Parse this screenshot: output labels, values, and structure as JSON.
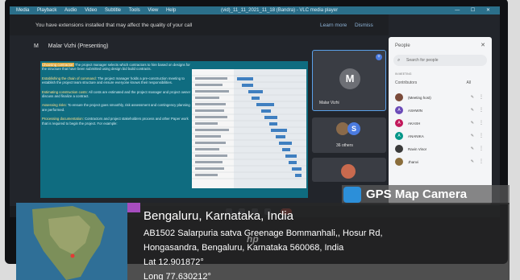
{
  "vlc": {
    "menus": [
      "Media",
      "Playback",
      "Audio",
      "Video",
      "Subtitle",
      "Tools",
      "View",
      "Help"
    ],
    "title": "(vid)_11_11_2021_11_18 (Bandra) - VLC media player",
    "window_controls": "— ☐ ✕"
  },
  "meet": {
    "notice": "You have extensions installed that may affect the quality of your call",
    "learn_more": "Learn more",
    "dismiss": "Dismiss",
    "presenter_initial": "M",
    "presenter_label": "Malar Vizhi (Presenting)",
    "slide": {
      "items": [
        {
          "head": "Choosing contractor:",
          "body": "The project manager selects which contractors to hire based on designs for the structure that have been submitted using design bid build contracts."
        },
        {
          "head": "Establishing the chain of command:",
          "body": "The project manager holds a pre-construction meeting to establish the project team structure and ensure everyone knows their responsibilities."
        },
        {
          "head": "Estimating construction costs:",
          "body": "All costs are estimated and the project manager and project owner discuss and finalize a contract."
        },
        {
          "head": "Assessing risks:",
          "body": "To ensure the project goes smoothly, risk assessment and contingency planning are performed."
        },
        {
          "head": "Processing documentation:",
          "body": "Contractors and project stakeholders process and other Paper work that is required to begin the project. For example:"
        }
      ]
    },
    "tiles": {
      "main_initial": "M",
      "main_name": "Malar Vizhi",
      "others_initial": "S",
      "others_label": "36 others"
    },
    "people": {
      "title": "People",
      "search_placeholder": "Search for people",
      "in_meeting": "IN MEETING",
      "contributors": "Contributors",
      "all": "All",
      "rows": [
        {
          "initial": "",
          "name": "(Meeting host)",
          "color": "#7a4a3a"
        },
        {
          "initial": "A",
          "name": "ASHWIN",
          "color": "#6b4bb8"
        },
        {
          "initial": "A",
          "name": "AKASH",
          "color": "#c2185b"
        },
        {
          "initial": "A",
          "name": "ANANIKA",
          "color": "#009688"
        },
        {
          "initial": "",
          "name": "Ravin Vinor",
          "color": "#3a3a3a"
        },
        {
          "initial": "",
          "name": "Jhanvi",
          "color": "#8a6d3b"
        }
      ]
    }
  },
  "gps": {
    "brand": "GPS Map Camera",
    "city": "Bengaluru, Karnataka, India",
    "address_line1": "AB1502 Salarpuria satva Greenage Bommanhali,, Hosur Rd,",
    "address_line2": "Hongasandra, Bengaluru, Karnataka 560068, India",
    "lat": "Lat 12.901872°",
    "long": "Long 77.630212°"
  },
  "monitor_brand": "hp"
}
